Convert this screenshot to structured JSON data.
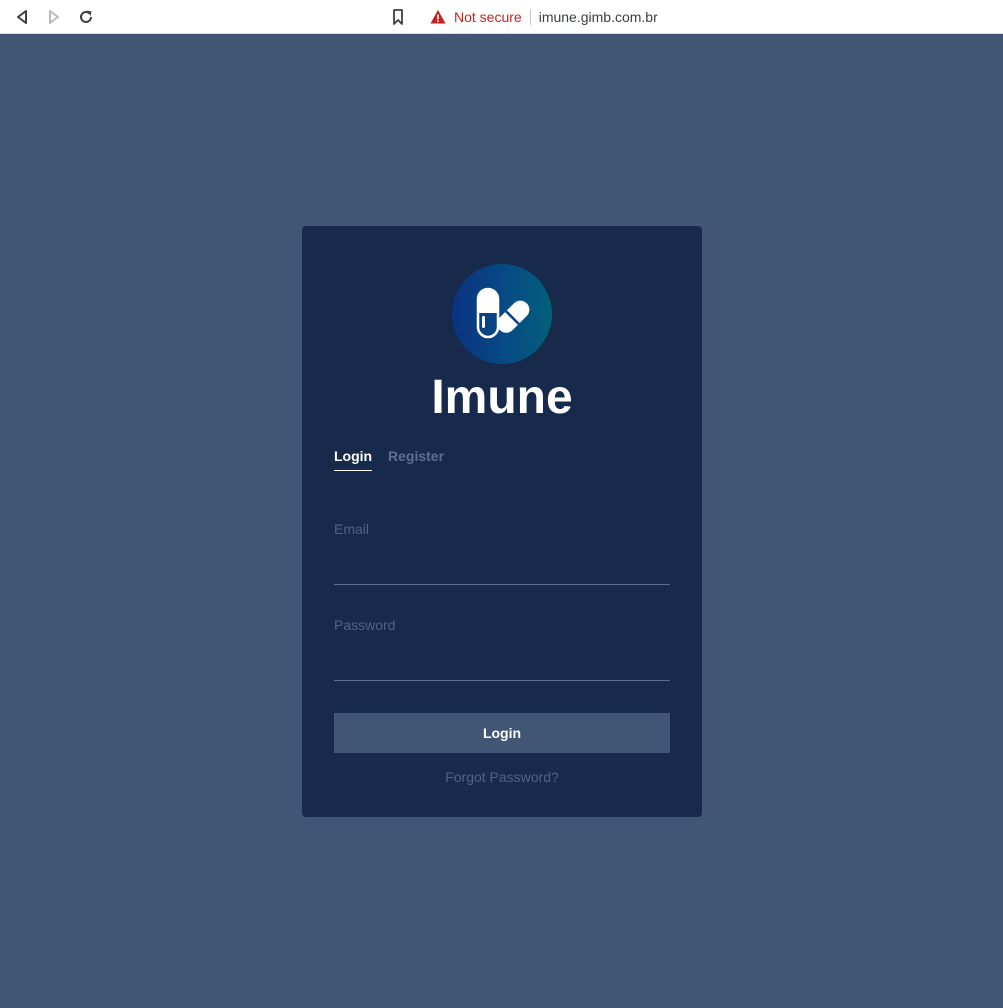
{
  "browser": {
    "security_label": "Not secure",
    "url": "imune.gimb.com.br",
    "icons": [
      "back-arrow-icon",
      "forward-arrow-icon",
      "reload-icon",
      "bookmark-icon",
      "warning-icon"
    ]
  },
  "brand": {
    "name": "Imune",
    "logo_icon": "pills-icon"
  },
  "tabs": [
    {
      "label": "Login",
      "active": true
    },
    {
      "label": "Register",
      "active": false
    }
  ],
  "form": {
    "email_label": "Email",
    "email_value": "",
    "password_label": "Password",
    "password_value": "",
    "submit_label": "Login",
    "forgot_label": "Forgot Password?"
  },
  "colors": {
    "page_background": "#415674",
    "card_background": "#172a4c",
    "button_background": "#415674",
    "muted_text": "#4f6383",
    "warning": "#c5221f"
  }
}
